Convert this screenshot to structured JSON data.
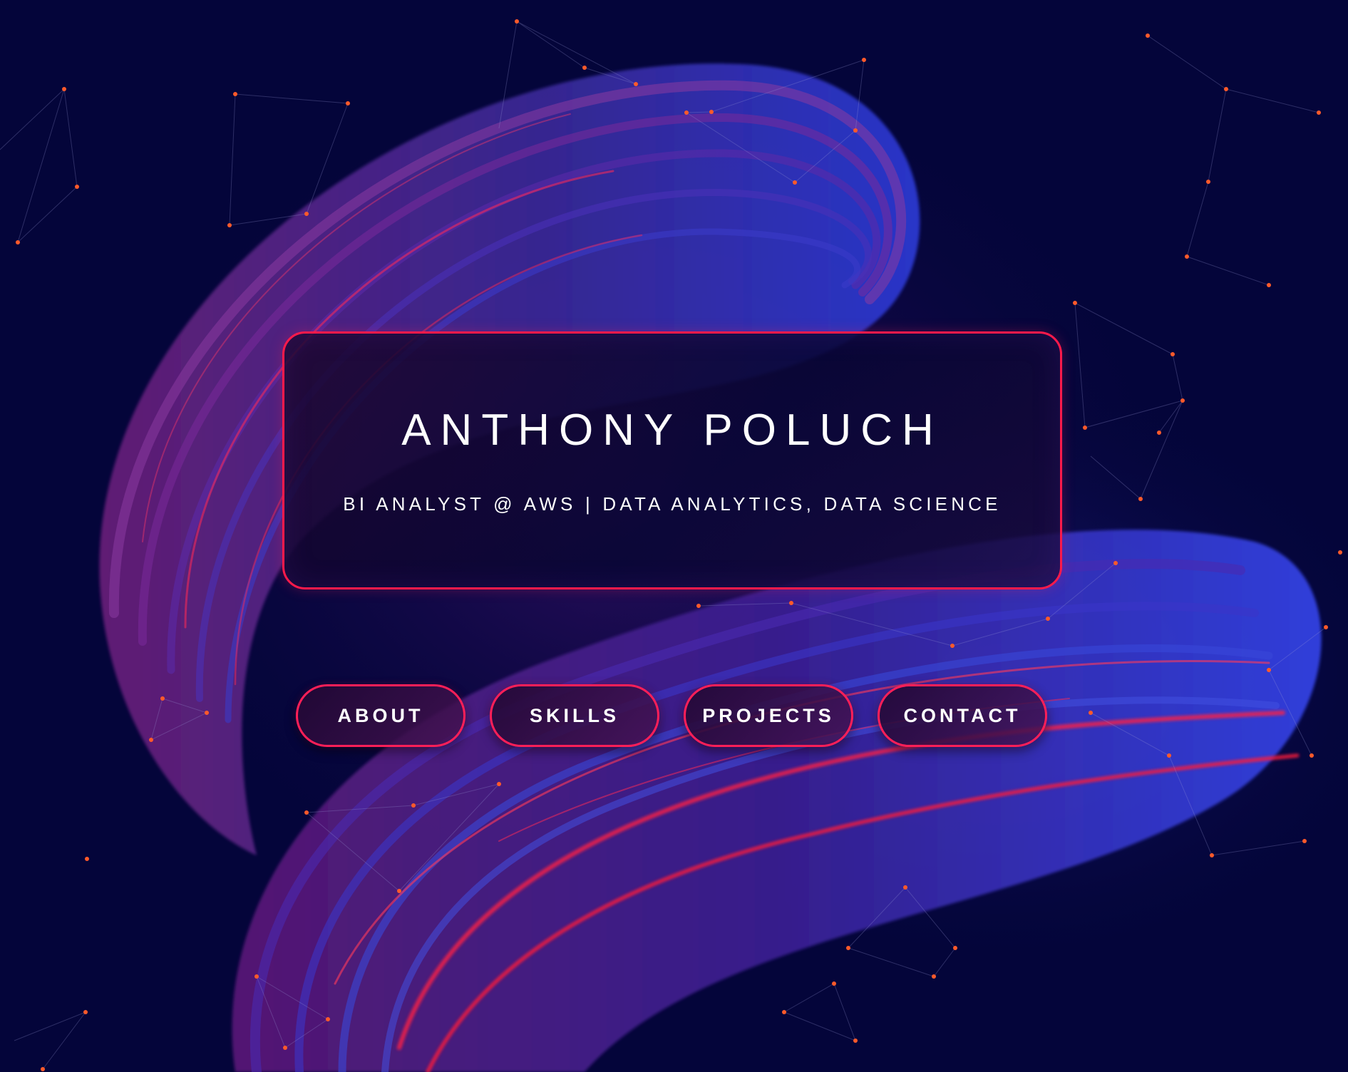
{
  "hero": {
    "name": "ANTHONY POLUCH",
    "tagline": "BI ANALYST @ AWS | DATA ANALYTICS, DATA SCIENCE"
  },
  "nav": {
    "items": [
      {
        "label": "ABOUT"
      },
      {
        "label": "SKILLS"
      },
      {
        "label": "PROJECTS"
      },
      {
        "label": "CONTACT"
      }
    ]
  },
  "colors": {
    "background": "#04053a",
    "accent": "#ff1a4b",
    "text": "#ffffff",
    "network_dot": "#ff5a2a"
  },
  "icons": {
    "background_art": "abstract-swirl-with-network"
  }
}
